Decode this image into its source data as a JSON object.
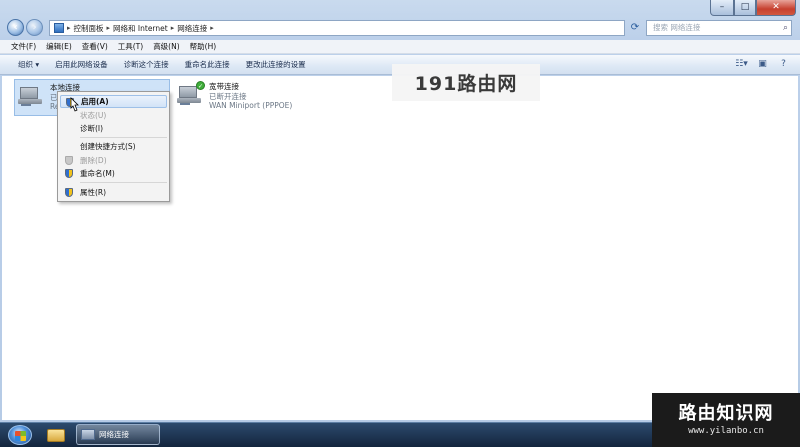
{
  "address_bar": {
    "crumbs": [
      "控制面板",
      "网络和 Internet",
      "网络连接"
    ]
  },
  "search": {
    "placeholder": "搜索 网络连接"
  },
  "window_controls": {
    "minimize": "–",
    "maximize": "□",
    "close": "✕"
  },
  "menubar": [
    "文件(F)",
    "编辑(E)",
    "查看(V)",
    "工具(T)",
    "高级(N)",
    "帮助(H)"
  ],
  "commandbar": [
    "组织 ▾",
    "启用此网络设备",
    "诊断这个连接",
    "重命名此连接",
    "更改此连接的设置"
  ],
  "connections": {
    "local": {
      "name": "本地连接",
      "status": "已",
      "device": "Re"
    },
    "broadband": {
      "name": "宽带连接",
      "status": "已断开连接",
      "device": "WAN Miniport (PPPOE)"
    }
  },
  "watermark": "191路由网",
  "context_menu": {
    "items": [
      {
        "label": "启用(A)",
        "state": "highlighted",
        "icon": "shield-icon"
      },
      {
        "label": "状态(U)",
        "state": "disabled",
        "icon": ""
      },
      {
        "label": "诊断(I)",
        "state": "normal",
        "icon": ""
      },
      {
        "label": "创建快捷方式(S)",
        "state": "normal",
        "icon": ""
      },
      {
        "label": "删除(D)",
        "state": "disabled",
        "icon": "shield-icon"
      },
      {
        "label": "重命名(M)",
        "state": "normal",
        "icon": "shield-icon"
      },
      {
        "label": "属性(R)",
        "state": "normal",
        "icon": "shield-icon"
      }
    ]
  },
  "taskbar": {
    "active_window": "网络连接"
  },
  "brand": {
    "title": "路由知识网",
    "url": "www.yilanbo.cn"
  }
}
